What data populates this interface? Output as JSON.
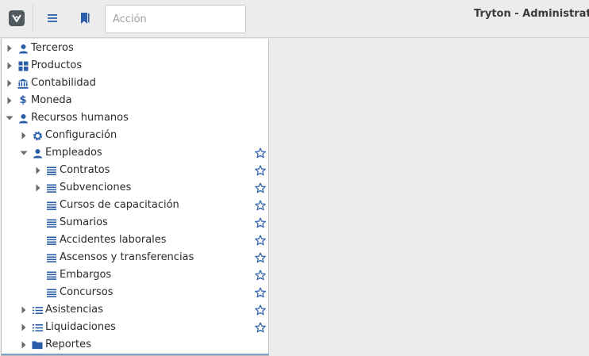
{
  "toolbar": {
    "search_placeholder": "Acción",
    "title": "Tryton - Administrator"
  },
  "colors": {
    "icon_blue": "#2a5ea8",
    "accent": "#7aa0c8"
  },
  "tree": [
    {
      "label": "Terceros",
      "icon": "person-icon",
      "expander": "collapsed",
      "level": 0,
      "star": false
    },
    {
      "label": "Productos",
      "icon": "grid-icon",
      "expander": "collapsed",
      "level": 0,
      "star": false
    },
    {
      "label": "Contabilidad",
      "icon": "bank-icon",
      "expander": "collapsed",
      "level": 0,
      "star": false
    },
    {
      "label": "Moneda",
      "icon": "dollar-icon",
      "expander": "collapsed",
      "level": 0,
      "star": false
    },
    {
      "label": "Recursos humanos",
      "icon": "person-icon",
      "expander": "expanded",
      "level": 0,
      "star": false
    },
    {
      "label": "Configuración",
      "icon": "gear-icon",
      "expander": "collapsed",
      "level": 1,
      "star": false
    },
    {
      "label": "Empleados",
      "icon": "person-icon",
      "expander": "expanded",
      "level": 1,
      "star": true
    },
    {
      "label": "Contratos",
      "icon": "list-icon",
      "expander": "collapsed",
      "level": 2,
      "star": true
    },
    {
      "label": "Subvenciones",
      "icon": "list-icon",
      "expander": "collapsed",
      "level": 2,
      "star": true
    },
    {
      "label": "Cursos de capacitación",
      "icon": "list-icon",
      "expander": "none",
      "level": 2,
      "star": true
    },
    {
      "label": "Sumarios",
      "icon": "list-icon",
      "expander": "none",
      "level": 2,
      "star": true
    },
    {
      "label": "Accidentes laborales",
      "icon": "list-icon",
      "expander": "none",
      "level": 2,
      "star": true
    },
    {
      "label": "Ascensos y transferencias",
      "icon": "list-icon",
      "expander": "none",
      "level": 2,
      "star": true
    },
    {
      "label": "Embargos",
      "icon": "list-icon",
      "expander": "none",
      "level": 2,
      "star": true
    },
    {
      "label": "Concursos",
      "icon": "list-icon",
      "expander": "none",
      "level": 2,
      "star": true
    },
    {
      "label": "Asistencias",
      "icon": "bullet-list-icon",
      "expander": "collapsed",
      "level": 1,
      "star": true
    },
    {
      "label": "Liquidaciones",
      "icon": "bullet-list-icon",
      "expander": "collapsed",
      "level": 1,
      "star": true
    },
    {
      "label": "Reportes",
      "icon": "folder-icon",
      "expander": "collapsed",
      "level": 1,
      "star": false
    }
  ]
}
